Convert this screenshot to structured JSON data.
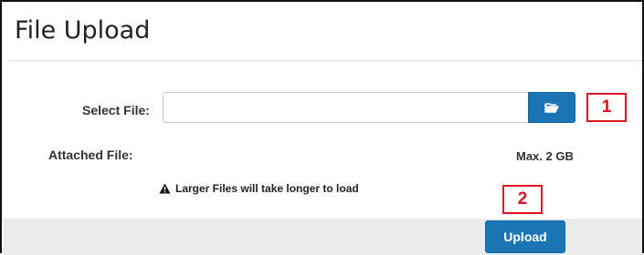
{
  "header": {
    "title": "File Upload"
  },
  "form": {
    "select_file_label": "Select File:",
    "file_value": "",
    "file_placeholder": "",
    "browse_icon": "folder-open-icon",
    "attached_file_label": "Attached File:",
    "max_size_text": "Max. 2 GB",
    "warning_icon": "warning-triangle-icon",
    "warning_text": "Larger Files will take longer to load"
  },
  "callouts": {
    "first": "1",
    "second": "2"
  },
  "footer": {
    "upload_label": "Upload"
  },
  "colors": {
    "primary_button": "#1b74b4",
    "callout_red": "#e0141e",
    "footer_bg": "#ebebeb"
  }
}
